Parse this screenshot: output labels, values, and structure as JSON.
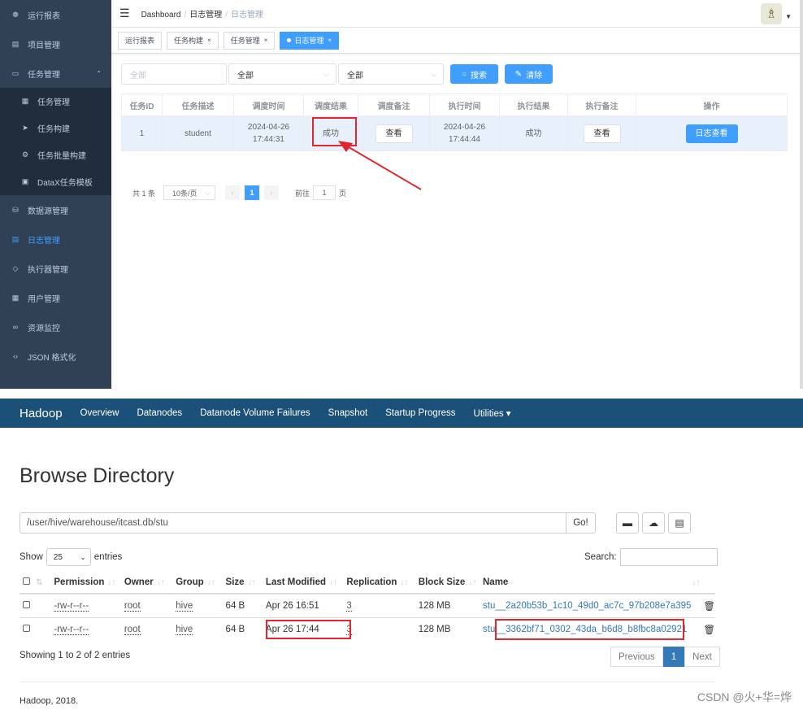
{
  "sidebar": {
    "items": [
      {
        "label": "运行报表",
        "icon": "dashboard-icon",
        "glyph": "❁"
      },
      {
        "label": "项目管理",
        "icon": "project-icon",
        "glyph": "▤"
      },
      {
        "label": "任务管理",
        "icon": "monitor-icon",
        "glyph": "▭",
        "expanded": true
      },
      {
        "label": "任务管理",
        "icon": "task-list-icon",
        "glyph": "▦",
        "sub": true
      },
      {
        "label": "任务构建",
        "icon": "send-icon",
        "glyph": "➤",
        "sub": true
      },
      {
        "label": "任务批量构建",
        "icon": "gear-icon",
        "glyph": "⚙",
        "sub": true
      },
      {
        "label": "DataX任务模板",
        "icon": "clipboard-icon",
        "glyph": "▣",
        "sub": true
      },
      {
        "label": "数据源管理",
        "icon": "database-icon",
        "glyph": "⛁"
      },
      {
        "label": "日志管理",
        "icon": "log-icon",
        "glyph": "▤",
        "active": true
      },
      {
        "label": "执行器管理",
        "icon": "executor-icon",
        "glyph": "◇"
      },
      {
        "label": "用户管理",
        "icon": "user-table-icon",
        "glyph": "▦"
      },
      {
        "label": "资源监控",
        "icon": "monitor-loop-icon",
        "glyph": "∞"
      },
      {
        "label": "JSON 格式化",
        "icon": "json-icon",
        "glyph": "‹›"
      }
    ]
  },
  "navbar": {
    "breadcrumb": [
      "Dashboard",
      "日志管理",
      "日志管理"
    ]
  },
  "tags": [
    {
      "label": "运行报表",
      "closable": false
    },
    {
      "label": "任务构建",
      "closable": true
    },
    {
      "label": "任务管理",
      "closable": true
    },
    {
      "label": "日志管理",
      "closable": true,
      "active": true
    }
  ],
  "filters": {
    "job_placeholder": "全部",
    "select1": "全部",
    "select2": "全部",
    "search_label": "搜索",
    "clear_label": "清除"
  },
  "jobs_table": {
    "headers": [
      "任务ID",
      "任务描述",
      "调度时间",
      "调度结果",
      "调度备注",
      "执行时间",
      "执行结果",
      "执行备注",
      "操作"
    ],
    "row": {
      "id": "1",
      "desc": "student",
      "trigger_time": "2024-04-26 17:44:31",
      "trigger_result": "成功",
      "trigger_note": "查看",
      "exec_time": "2024-04-26 17:44:44",
      "exec_result": "成功",
      "exec_note": "查看",
      "action": "日志查看"
    }
  },
  "pagination": {
    "total": "共 1 条",
    "page_size": "10条/页",
    "current": "1",
    "goto_label": "前往",
    "goto_value": "1",
    "page_suffix": "页"
  },
  "hadoop": {
    "brand": "Hadoop",
    "nav": [
      "Overview",
      "Datanodes",
      "Datanode Volume Failures",
      "Snapshot",
      "Startup Progress",
      "Utilities ▾"
    ],
    "title": "Browse Directory",
    "path": "/user/hive/warehouse/itcast.db/stu",
    "go": "Go!",
    "show_label": "Show",
    "entries_value": "25",
    "entries_label": "entries",
    "search_label": "Search:",
    "headers": [
      "Permission",
      "Owner",
      "Group",
      "Size",
      "Last Modified",
      "Replication",
      "Block Size",
      "Name"
    ],
    "rows": [
      {
        "permission": "-rw-r--r--",
        "owner": "root",
        "group": "hive",
        "size": "64 B",
        "modified": "Apr 26 16:51",
        "replication": "3",
        "block": "128 MB",
        "name": "stu__2a20b53b_1c10_49d0_ac7c_97b208e7a395"
      },
      {
        "permission": "-rw-r--r--",
        "owner": "root",
        "group": "hive",
        "size": "64 B",
        "modified": "Apr 26 17:44",
        "replication": "3",
        "block": "128 MB",
        "name": "stu__3362bf71_0302_43da_b6d8_b8fbc8a02921"
      }
    ],
    "showing": "Showing 1 to 2 of 2 entries",
    "prev": "Previous",
    "page": "1",
    "next": "Next",
    "footer": "Hadoop, 2018."
  },
  "watermark": "CSDN @火+华=烨",
  "colors": {
    "sidebar_bg": "#304156",
    "accent": "#409eff",
    "hadoop_nav": "#1b5178",
    "annotation_red": "#e0262e"
  }
}
